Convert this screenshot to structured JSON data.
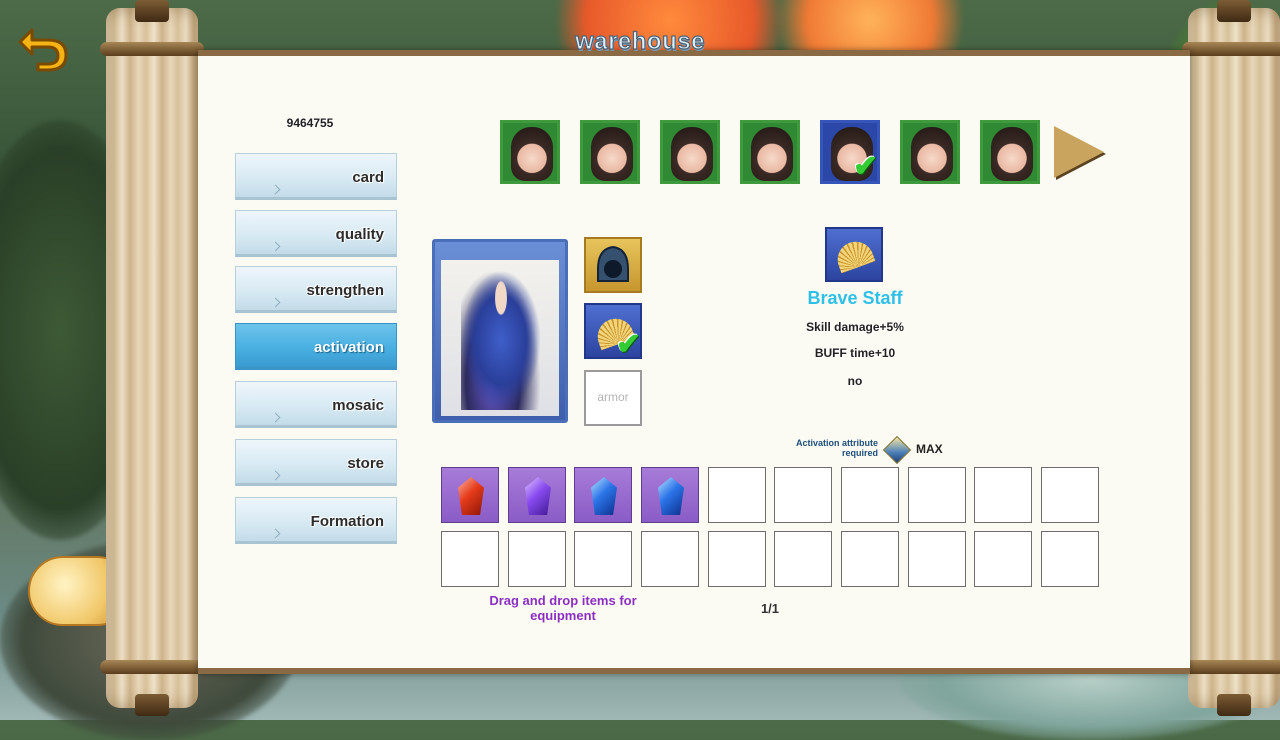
{
  "title": "warehouse",
  "power": "9464755",
  "menu": [
    {
      "label": "card",
      "active": false
    },
    {
      "label": "quality",
      "active": false
    },
    {
      "label": "strengthen",
      "active": false
    },
    {
      "label": "activation",
      "active": true
    },
    {
      "label": "mosaic",
      "active": false
    },
    {
      "label": "store",
      "active": false
    },
    {
      "label": "Formation",
      "active": false
    }
  ],
  "heroes": [
    {
      "frame": "green",
      "selected": false
    },
    {
      "frame": "green",
      "selected": false
    },
    {
      "frame": "green",
      "selected": false
    },
    {
      "frame": "green",
      "selected": false
    },
    {
      "frame": "blue",
      "selected": true
    },
    {
      "frame": "green",
      "selected": false
    },
    {
      "frame": "green",
      "selected": false
    }
  ],
  "equipment": {
    "helmet_icon": "hood-icon",
    "weapon_icon": "fan-icon",
    "armor_label": "armor"
  },
  "item": {
    "name": "Brave Staff",
    "icon": "fan-icon",
    "stats": [
      "Skill damage+5%",
      "BUFF time+10",
      "no"
    ],
    "requirement_label": "Activation attribute required",
    "requirement_value": "MAX"
  },
  "gems": [
    "red",
    "violet",
    "blue",
    "blue"
  ],
  "hint": "Drag and drop items for equipment",
  "page": "1/1",
  "colors": {
    "accent": "#2fc0e8",
    "active_tab": "#47aee0",
    "hint": "#8b2fbf"
  }
}
